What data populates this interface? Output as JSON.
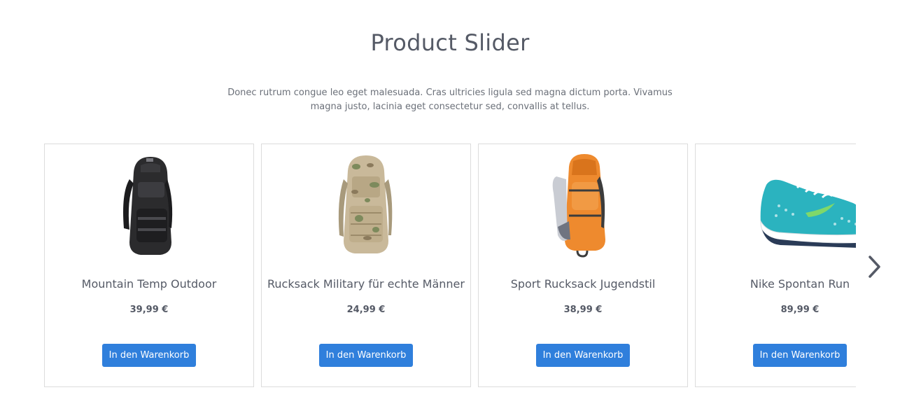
{
  "section": {
    "title": "Product Slider",
    "description": "Donec rutrum congue leo eget malesuada. Cras ultricies ligula sed magna dictum porta. Vivamus magna justo, lacinia eget consectetur sed, convallis at tellus."
  },
  "products": [
    {
      "name": "Mountain Temp Outdoor",
      "price": "39,99 €",
      "button": "In den Warenkorb",
      "image": "black-backpack"
    },
    {
      "name": "Rucksack Military für echte Männer",
      "price": "24,99 €",
      "button": "In den Warenkorb",
      "image": "camo-backpack"
    },
    {
      "name": "Sport Rucksack Jugendstil",
      "price": "38,99 €",
      "button": "In den Warenkorb",
      "image": "orange-backpack"
    },
    {
      "name": "Nike Spontan Run",
      "price": "89,99 €",
      "button": "In den Warenkorb",
      "image": "teal-running-shoe"
    }
  ],
  "slider": {
    "next_icon": "chevron-right-icon"
  },
  "colors": {
    "accent": "#2f7fdc",
    "text": "#555a66",
    "border": "#dcdcdc"
  }
}
